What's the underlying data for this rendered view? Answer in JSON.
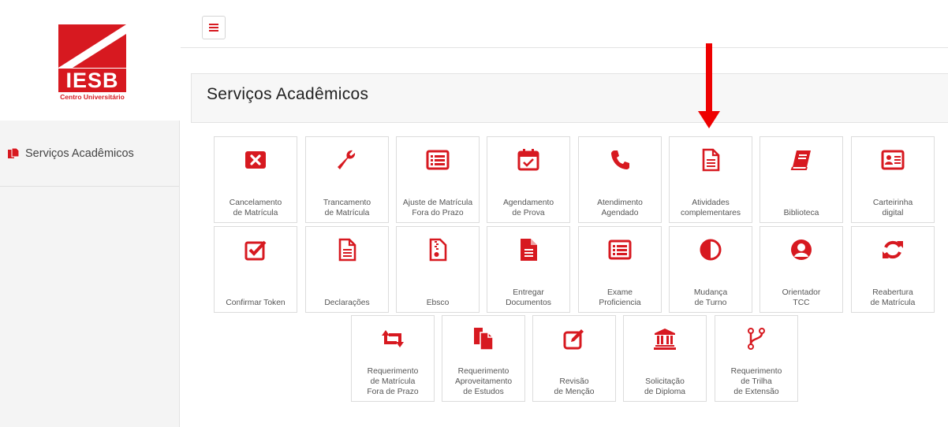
{
  "brand": {
    "wordmark": "IESB",
    "subtitle": "Centro Universitário",
    "red": "#d71920"
  },
  "sidebar": {
    "items": [
      {
        "label": "Serviços Acadêmicos",
        "icon": "documents-icon"
      }
    ]
  },
  "topbar": {
    "menu_icon": "hamburger-menu-icon"
  },
  "page": {
    "title": "Serviços Acadêmicos"
  },
  "annotation": {
    "icon": "red-down-arrow",
    "color": "#ee0000"
  },
  "services": [
    {
      "line1": "Cancelamento",
      "line2": "de Matrícula",
      "line3": "",
      "icon": "cancel-box-icon"
    },
    {
      "line1": "Trancamento",
      "line2": "de Matrícula",
      "line3": "",
      "icon": "wrench-icon"
    },
    {
      "line1": "Ajuste de Matrícula",
      "line2": "Fora do Prazo",
      "line3": "",
      "icon": "list-card-icon"
    },
    {
      "line1": "Agendamento",
      "line2": "de Prova",
      "line3": "",
      "icon": "calendar-check-icon"
    },
    {
      "line1": "Atendimento",
      "line2": "Agendado",
      "line3": "",
      "icon": "phone-icon"
    },
    {
      "line1": "Atividades",
      "line2": "complementares",
      "line3": "",
      "icon": "document-icon"
    },
    {
      "line1": "",
      "line2": "Biblioteca",
      "line3": "",
      "icon": "book-icon"
    },
    {
      "line1": "Carteirinha",
      "line2": "digital",
      "line3": "",
      "icon": "id-card-icon"
    },
    {
      "line1": "",
      "line2": "Confirmar Token",
      "line3": "",
      "icon": "checkbox-icon"
    },
    {
      "line1": "",
      "line2": "Declarações",
      "line3": "",
      "icon": "document-icon"
    },
    {
      "line1": "",
      "line2": "Ebsco",
      "line3": "",
      "icon": "zip-file-icon"
    },
    {
      "line1": "Entregar",
      "line2": "Documentos",
      "line3": "",
      "icon": "filled-document-icon"
    },
    {
      "line1": "Exame",
      "line2": "Proficiencia",
      "line3": "",
      "icon": "list-card-icon"
    },
    {
      "line1": "Mudança",
      "line2": "de Turno",
      "line3": "",
      "icon": "half-circle-icon"
    },
    {
      "line1": "Orientador",
      "line2": "TCC",
      "line3": "",
      "icon": "user-circle-icon"
    },
    {
      "line1": "Reabertura",
      "line2": "de Matrícula",
      "line3": "",
      "icon": "refresh-icon"
    },
    {
      "line1": "Requerimento",
      "line2": "de Matrícula",
      "line3": "Fora de Prazo",
      "icon": "retweet-icon"
    },
    {
      "line1": "Requerimento",
      "line2": "Aproveitamento",
      "line3": "de Estudos",
      "icon": "copy-files-icon"
    },
    {
      "line1": "Revisão",
      "line2": "de Menção",
      "line3": "",
      "icon": "edit-icon"
    },
    {
      "line1": "Solicitação",
      "line2": "de Diploma",
      "line3": "",
      "icon": "institution-icon"
    },
    {
      "line1": "Requerimento",
      "line2": "de Trilha",
      "line3": "de Extensão",
      "icon": "branch-icon"
    }
  ]
}
